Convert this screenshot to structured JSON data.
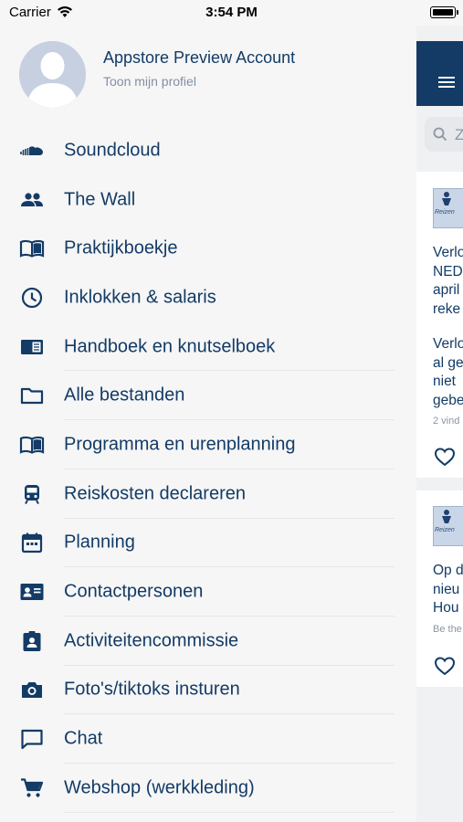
{
  "status_bar": {
    "carrier": "Carrier",
    "time": "3:54 PM"
  },
  "profile": {
    "name": "Appstore Preview Account",
    "link": "Toon mijn profiel"
  },
  "menu": [
    {
      "label": "Soundcloud",
      "icon": "soundcloud-icon"
    },
    {
      "label": "The Wall",
      "icon": "group-icon"
    },
    {
      "label": "Praktijkboekje",
      "icon": "open-book-icon"
    },
    {
      "label": "Inklokken & salaris",
      "icon": "clock-icon"
    },
    {
      "label": "Handboek en knutselboek",
      "icon": "notebook-icon"
    },
    {
      "label": "Alle bestanden",
      "icon": "folder-icon"
    },
    {
      "label": "Programma en urenplanning",
      "icon": "open-book-icon"
    },
    {
      "label": "Reiskosten declareren",
      "icon": "train-icon"
    },
    {
      "label": "Planning",
      "icon": "calendar-icon"
    },
    {
      "label": "Contactpersonen",
      "icon": "contact-card-icon"
    },
    {
      "label": "Activiteitencommissie",
      "icon": "badge-icon"
    },
    {
      "label": "Foto's/tiktoks insturen",
      "icon": "camera-icon"
    },
    {
      "label": "Chat",
      "icon": "chat-icon"
    },
    {
      "label": "Webshop (werkkleding)",
      "icon": "cart-icon"
    }
  ],
  "content": {
    "search_placeholder": "Z",
    "post1": {
      "thumb_text": "Reizen",
      "lines": [
        "Verlo",
        "NED",
        "april",
        "reke",
        "Verlo",
        "al ge",
        "niet",
        "gebe"
      ],
      "meta": "2 vind"
    },
    "post2": {
      "thumb_text": "Reizen",
      "lines": [
        "Op d",
        "nieu",
        "Hou"
      ],
      "meta": "Be the"
    }
  },
  "colors": {
    "primary": "#133b66",
    "drawer_bg": "#f6f6f6",
    "muted": "#8190a3"
  }
}
